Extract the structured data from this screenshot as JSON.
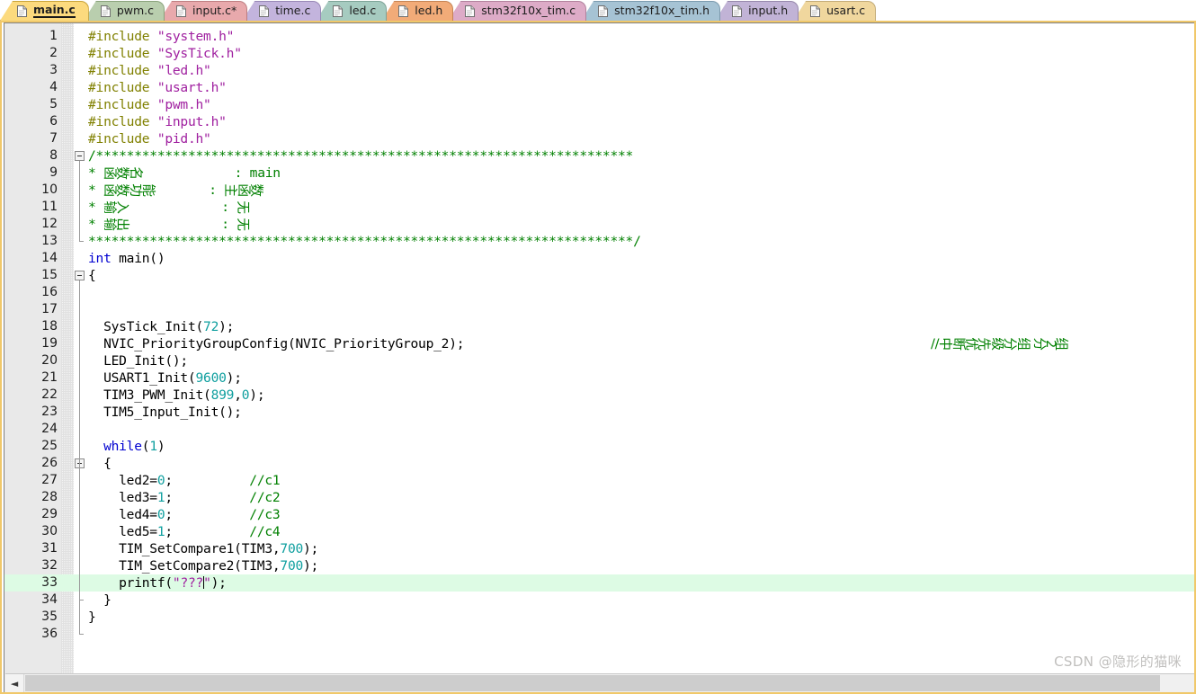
{
  "tabs": [
    {
      "label": "main.c",
      "active": true,
      "bg": "#fcda7e",
      "border": "#c8a33a",
      "icon": "document-icon"
    },
    {
      "label": "pwm.c",
      "active": false,
      "bg": "#b9ceae",
      "border": "#8aa37c",
      "icon": "document-icon"
    },
    {
      "label": "input.c*",
      "active": false,
      "bg": "#e8a9ac",
      "border": "#bd7e81",
      "icon": "document-icon"
    },
    {
      "label": "time.c",
      "active": false,
      "bg": "#c3b4dd",
      "border": "#9887b5",
      "icon": "document-icon"
    },
    {
      "label": "led.c",
      "active": false,
      "bg": "#a6cbc0",
      "border": "#7da397",
      "icon": "document-icon"
    },
    {
      "label": "led.h",
      "active": false,
      "bg": "#f2ab78",
      "border": "#c48354",
      "icon": "document-icon"
    },
    {
      "label": "stm32f10x_tim.c",
      "active": false,
      "bg": "#ddabc7",
      "border": "#b0819c",
      "icon": "document-icon"
    },
    {
      "label": "stm32f10x_tim.h",
      "active": false,
      "bg": "#a6c3d4",
      "border": "#7b9aad",
      "icon": "document-icon"
    },
    {
      "label": "input.h",
      "active": false,
      "bg": "#c1b3d6",
      "border": "#9688ab",
      "icon": "document-icon"
    },
    {
      "label": "usart.c",
      "active": false,
      "bg": "#f0d79e",
      "border": "#c2ab78",
      "icon": "document-icon"
    }
  ],
  "editor": {
    "active_file": "main.c",
    "highlighted_line": 33,
    "caret_line": 33,
    "total_lines": 36,
    "colors": {
      "preprocessor": "#808000",
      "string": "#a020a0",
      "comment": "#008000",
      "keyword": "#0000d0",
      "number": "#0f9f9f",
      "identifier": "#000000",
      "current_line_highlight": "#ddfbe4",
      "gutter_bg": "#e9e9e9",
      "frame_border": "#f0c86a"
    },
    "line_numbers": [
      1,
      2,
      3,
      4,
      5,
      6,
      7,
      8,
      9,
      10,
      11,
      12,
      13,
      14,
      15,
      16,
      17,
      18,
      19,
      20,
      21,
      22,
      23,
      24,
      25,
      26,
      27,
      28,
      29,
      30,
      31,
      32,
      33,
      34,
      35,
      36
    ],
    "lines": [
      {
        "n": 1,
        "tokens": [
          {
            "t": "#include ",
            "c": "pre"
          },
          {
            "t": "\"system.h\"",
            "c": "str"
          }
        ]
      },
      {
        "n": 2,
        "tokens": [
          {
            "t": "#include ",
            "c": "pre"
          },
          {
            "t": "\"SysTick.h\"",
            "c": "str"
          }
        ]
      },
      {
        "n": 3,
        "tokens": [
          {
            "t": "#include ",
            "c": "pre"
          },
          {
            "t": "\"led.h\"",
            "c": "str"
          }
        ]
      },
      {
        "n": 4,
        "tokens": [
          {
            "t": "#include ",
            "c": "pre"
          },
          {
            "t": "\"usart.h\"",
            "c": "str"
          }
        ]
      },
      {
        "n": 5,
        "tokens": [
          {
            "t": "#include ",
            "c": "pre"
          },
          {
            "t": "\"pwm.h\"",
            "c": "str"
          }
        ]
      },
      {
        "n": 6,
        "tokens": [
          {
            "t": "#include ",
            "c": "pre"
          },
          {
            "t": "\"input.h\"",
            "c": "str"
          }
        ]
      },
      {
        "n": 7,
        "tokens": [
          {
            "t": "#include ",
            "c": "pre"
          },
          {
            "t": "\"pid.h\"",
            "c": "str"
          }
        ]
      },
      {
        "n": 8,
        "tokens": [
          {
            "t": "/**********************************************************************",
            "c": "cmt"
          }
        ]
      },
      {
        "n": 9,
        "tokens": [
          {
            "t": "* ",
            "c": "cmt"
          },
          {
            "t": "函数名",
            "c": "cmt-cjk"
          },
          {
            "t": "            : main",
            "c": "cmt"
          }
        ]
      },
      {
        "n": 10,
        "tokens": [
          {
            "t": "* ",
            "c": "cmt"
          },
          {
            "t": "函数功能",
            "c": "cmt-cjk"
          },
          {
            "t": "       : ",
            "c": "cmt"
          },
          {
            "t": "主函数",
            "c": "cmt-cjk"
          }
        ]
      },
      {
        "n": 11,
        "tokens": [
          {
            "t": "* ",
            "c": "cmt"
          },
          {
            "t": "输入",
            "c": "cmt-cjk"
          },
          {
            "t": "            : ",
            "c": "cmt"
          },
          {
            "t": "无",
            "c": "cmt-cjk"
          }
        ]
      },
      {
        "n": 12,
        "tokens": [
          {
            "t": "* ",
            "c": "cmt"
          },
          {
            "t": "输出",
            "c": "cmt-cjk"
          },
          {
            "t": "            : ",
            "c": "cmt"
          },
          {
            "t": "无",
            "c": "cmt-cjk"
          }
        ]
      },
      {
        "n": 13,
        "tokens": [
          {
            "t": "***********************************************************************/",
            "c": "cmt"
          }
        ]
      },
      {
        "n": 14,
        "tokens": [
          {
            "t": "int",
            "c": "kw"
          },
          {
            "t": " main()",
            "c": "id"
          }
        ]
      },
      {
        "n": 15,
        "tokens": [
          {
            "t": "{",
            "c": "id"
          }
        ]
      },
      {
        "n": 16,
        "tokens": []
      },
      {
        "n": 17,
        "tokens": []
      },
      {
        "n": 18,
        "tokens": [
          {
            "t": "  SysTick_Init(",
            "c": "id"
          },
          {
            "t": "72",
            "c": "num"
          },
          {
            "t": ");",
            "c": "id"
          }
        ]
      },
      {
        "n": 19,
        "tokens": [
          {
            "t": "  NVIC_PriorityGroupConfig(NVIC_PriorityGroup_2);",
            "c": "id"
          }
        ]
      },
      {
        "n": 20,
        "tokens": [
          {
            "t": "  LED_Init();",
            "c": "id"
          }
        ]
      },
      {
        "n": 21,
        "tokens": [
          {
            "t": "  USART1_Init(",
            "c": "id"
          },
          {
            "t": "9600",
            "c": "num"
          },
          {
            "t": ");",
            "c": "id"
          }
        ]
      },
      {
        "n": 22,
        "tokens": [
          {
            "t": "  TIM3_PWM_Init(",
            "c": "id"
          },
          {
            "t": "899",
            "c": "num"
          },
          {
            "t": ",",
            "c": "id"
          },
          {
            "t": "0",
            "c": "num"
          },
          {
            "t": ");",
            "c": "id"
          }
        ]
      },
      {
        "n": 23,
        "tokens": [
          {
            "t": "  TIM5_Input_Init();",
            "c": "id"
          }
        ]
      },
      {
        "n": 24,
        "tokens": []
      },
      {
        "n": 25,
        "tokens": [
          {
            "t": "  ",
            "c": "id"
          },
          {
            "t": "while",
            "c": "kw"
          },
          {
            "t": "(",
            "c": "id"
          },
          {
            "t": "1",
            "c": "num"
          },
          {
            "t": ")",
            "c": "id"
          }
        ]
      },
      {
        "n": 26,
        "tokens": [
          {
            "t": "  {",
            "c": "id"
          }
        ]
      },
      {
        "n": 27,
        "tokens": [
          {
            "t": "    led2=",
            "c": "id"
          },
          {
            "t": "0",
            "c": "num"
          },
          {
            "t": ";          ",
            "c": "id"
          },
          {
            "t": "//c1",
            "c": "cmt"
          }
        ]
      },
      {
        "n": 28,
        "tokens": [
          {
            "t": "    led3=",
            "c": "id"
          },
          {
            "t": "1",
            "c": "num"
          },
          {
            "t": ";          ",
            "c": "id"
          },
          {
            "t": "//c2",
            "c": "cmt"
          }
        ]
      },
      {
        "n": 29,
        "tokens": [
          {
            "t": "    led4=",
            "c": "id"
          },
          {
            "t": "0",
            "c": "num"
          },
          {
            "t": ";          ",
            "c": "id"
          },
          {
            "t": "//c3",
            "c": "cmt"
          }
        ]
      },
      {
        "n": 30,
        "tokens": [
          {
            "t": "    led5=",
            "c": "id"
          },
          {
            "t": "1",
            "c": "num"
          },
          {
            "t": ";          ",
            "c": "id"
          },
          {
            "t": "//c4",
            "c": "cmt"
          }
        ]
      },
      {
        "n": 31,
        "tokens": [
          {
            "t": "    TIM_SetCompare1(TIM3,",
            "c": "id"
          },
          {
            "t": "700",
            "c": "num"
          },
          {
            "t": ");",
            "c": "id"
          }
        ]
      },
      {
        "n": 32,
        "tokens": [
          {
            "t": "    TIM_SetCompare2(TIM3,",
            "c": "id"
          },
          {
            "t": "700",
            "c": "num"
          },
          {
            "t": ");",
            "c": "id"
          }
        ]
      },
      {
        "n": 33,
        "tokens": [
          {
            "t": "    printf(",
            "c": "id"
          },
          {
            "t": "\"???",
            "c": "str"
          },
          {
            "t": "|CARET|",
            "c": "caret"
          },
          {
            "t": "\"",
            "c": "str"
          },
          {
            "t": ");",
            "c": "id"
          }
        ]
      },
      {
        "n": 34,
        "tokens": [
          {
            "t": "  }",
            "c": "id"
          }
        ]
      },
      {
        "n": 35,
        "tokens": [
          {
            "t": "}",
            "c": "id"
          }
        ]
      },
      {
        "n": 36,
        "tokens": []
      }
    ],
    "trailing_comments": [
      {
        "line": 19,
        "text": "//中断优先级分组 分2组",
        "color": "#008000"
      }
    ],
    "fold_markers": [
      {
        "line": 8,
        "type": "box-minus"
      },
      {
        "line": 15,
        "type": "box-minus"
      },
      {
        "line": 26,
        "type": "box-minus"
      }
    ]
  },
  "scrollbar": {
    "left_arrow": "◄",
    "orientation": "horizontal",
    "position": "bottom"
  },
  "watermark": {
    "text": "CSDN @隐形的猫咪"
  }
}
